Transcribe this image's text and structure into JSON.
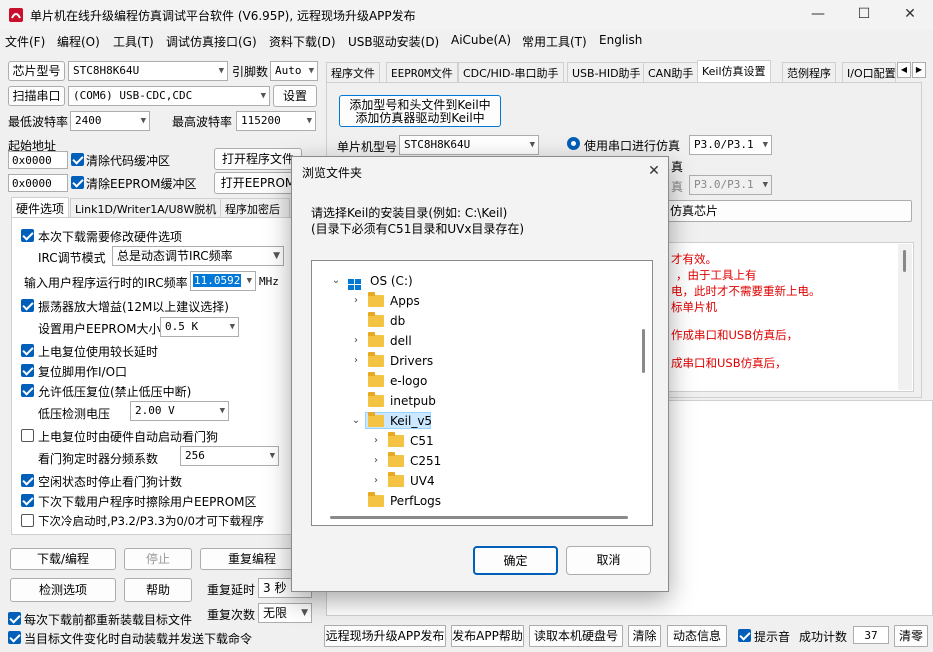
{
  "window": {
    "title": "单片机在线升级编程仿真调试平台软件 (V6.95P), 远程现场升级APP发布",
    "minimize": "—",
    "maximize": "☐",
    "close": "✕"
  },
  "menu": [
    "文件(F)",
    "编程(O)",
    "工具(T)",
    "调试仿真接口(G)",
    "资料下载(D)",
    "USB驱动安装(D)",
    "AiCube(A)",
    "常用工具(T)",
    "English"
  ],
  "left": {
    "chip_label": "芯片型号",
    "chip_value": "STC8H8K64U",
    "pins_label": "引脚数",
    "pins_value": "Auto",
    "scan_button": "扫描串口",
    "port_value": "(COM6) USB-CDC,CDC",
    "settings_button": "设置",
    "min_baud_label": "最低波特率",
    "min_baud_value": "2400",
    "max_baud_label": "最高波特率",
    "max_baud_value": "115200",
    "start_addr_label": "起始地址",
    "addr1": "0x0000",
    "clear_code": "清除代码缓冲区",
    "open_program": "打开程序文件",
    "addr2": "0x0000",
    "clear_eeprom": "清除EEPROM缓冲区",
    "open_eeprom": "打开EEPROM文件",
    "tabs": [
      "硬件选项",
      "Link1D/Writer1A/U8W脱机",
      "程序加密后"
    ],
    "options": {
      "modify_hw": "本次下载需要修改硬件选项",
      "irc_mode_label": "IRC调节模式",
      "irc_mode_value": "总是动态调节IRC频率",
      "irc_freq_label": "输入用户程序运行时的IRC频率",
      "irc_freq_value": "11.0592",
      "irc_unit": "MHz",
      "osc_gain": "振荡器放大增益(12M以上建议选择)",
      "eeprom_size_label": "设置用户EEPROM大小",
      "eeprom_size_value": "0.5 K",
      "power_delay": "上电复位使用较长延时",
      "reset_io": "复位脚用作I/O口",
      "low_volt_reset": "允许低压复位(禁止低压中断)",
      "low_volt_label": "低压检测电压",
      "low_volt_value": "2.00 V",
      "watchdog_auto": "上电复位时由硬件自动启动看门狗",
      "wdt_div_label": "看门狗定时器分频系数",
      "wdt_div_value": "256",
      "idle_stop_wdt": "空闲状态时停止看门狗计数",
      "erase_eeprom": "下次下载用户程序时擦除用户EEPROM区",
      "p32_p33": "下次冷启动时,P3.2/P3.3为0/0才可下载程序"
    },
    "download_btn": "下载/编程",
    "stop_btn": "停止",
    "reprogram_btn": "重复编程",
    "detect_btn": "检测选项",
    "help_btn": "帮助",
    "repeat_delay_label": "重复延时",
    "repeat_delay_value": "3 秒",
    "repeat_count_label": "重复次数",
    "repeat_count_value": "无限",
    "reload_each": "每次下载前都重新装载目标文件",
    "auto_send": "当目标文件变化时自动装载并发送下载命令"
  },
  "right": {
    "tabs": [
      "程序文件",
      "EEPROM文件",
      "CDC/HID-串口助手",
      "USB-HID助手",
      "CAN助手",
      "Keil仿真设置",
      "范例程序",
      "I/O口配置"
    ],
    "add_keil_line1": "添加型号和头文件到Keil中",
    "add_keil_line2": "添加仿真器驱动到Keil中",
    "mcu_label": "单片机型号",
    "mcu_value": "STC8H8K64U",
    "serial_emul": "使用串口进行仿真",
    "serial_pins": "P3.0/P3.1",
    "emul_tail": "真",
    "pins2_label": "真",
    "pins2_value": "P3.0/P3.1",
    "chip_btn_tail": "仿真芯片",
    "red_lines": [
      "才有效。",
      "，由于工具上有",
      "电，此时才不需要重新上电。",
      "标单片机",
      "作成串口和USB仿真后，",
      "成串口和USB仿真后，"
    ]
  },
  "bottom": {
    "remote_btn": "远程现场升级APP发布",
    "publish_help": "发布APP帮助",
    "read_hdd": "读取本机硬盘号",
    "clear": "清除",
    "dyn_info": "动态信息",
    "beep": "提示音",
    "success_label": "成功计数",
    "success_value": "37",
    "clear2": "清零"
  },
  "dialog": {
    "title": "浏览文件夹",
    "close": "✕",
    "desc1": "请选择Keil的安装目录(例如: C:\\Keil)",
    "desc2": "(目录下必须有C51目录和UVx目录存在)",
    "root": "OS (C:)",
    "folders": [
      "Apps",
      "db",
      "dell",
      "Drivers",
      "e-logo",
      "inetpub",
      "Keil_v5",
      "C51",
      "C251",
      "UV4",
      "PerfLogs"
    ],
    "ok": "确定",
    "cancel": "取消"
  },
  "colors": {
    "accent": "#005fb8",
    "red_text": "#e00000"
  }
}
